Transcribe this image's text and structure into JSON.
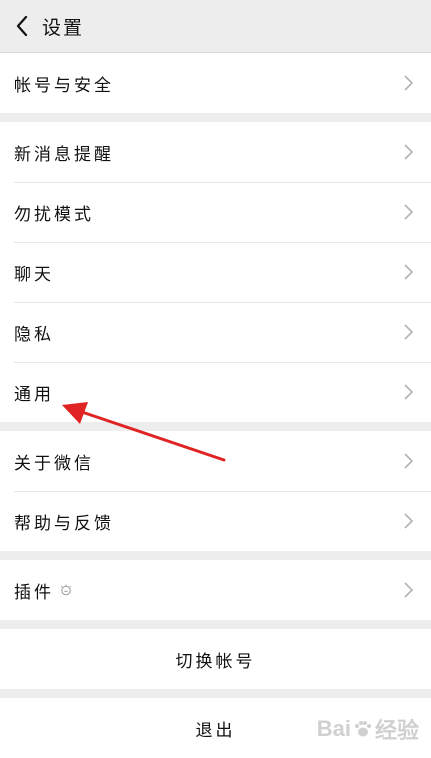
{
  "header": {
    "title": "设置"
  },
  "groups": [
    {
      "items": [
        {
          "label": "帐号与安全"
        }
      ]
    },
    {
      "items": [
        {
          "label": "新消息提醒"
        },
        {
          "label": "勿扰模式"
        },
        {
          "label": "聊天"
        },
        {
          "label": "隐私"
        },
        {
          "label": "通用"
        }
      ]
    },
    {
      "items": [
        {
          "label": "关于微信"
        },
        {
          "label": "帮助与反馈"
        }
      ]
    },
    {
      "items": [
        {
          "label": "插件",
          "icon": "bulb-icon"
        }
      ]
    }
  ],
  "actions": {
    "switch_account": "切换帐号",
    "logout": "退出"
  },
  "annotation": {
    "color": "#e02424"
  },
  "watermark": {
    "brand_left": "Bai",
    "brand_right": "经验"
  }
}
